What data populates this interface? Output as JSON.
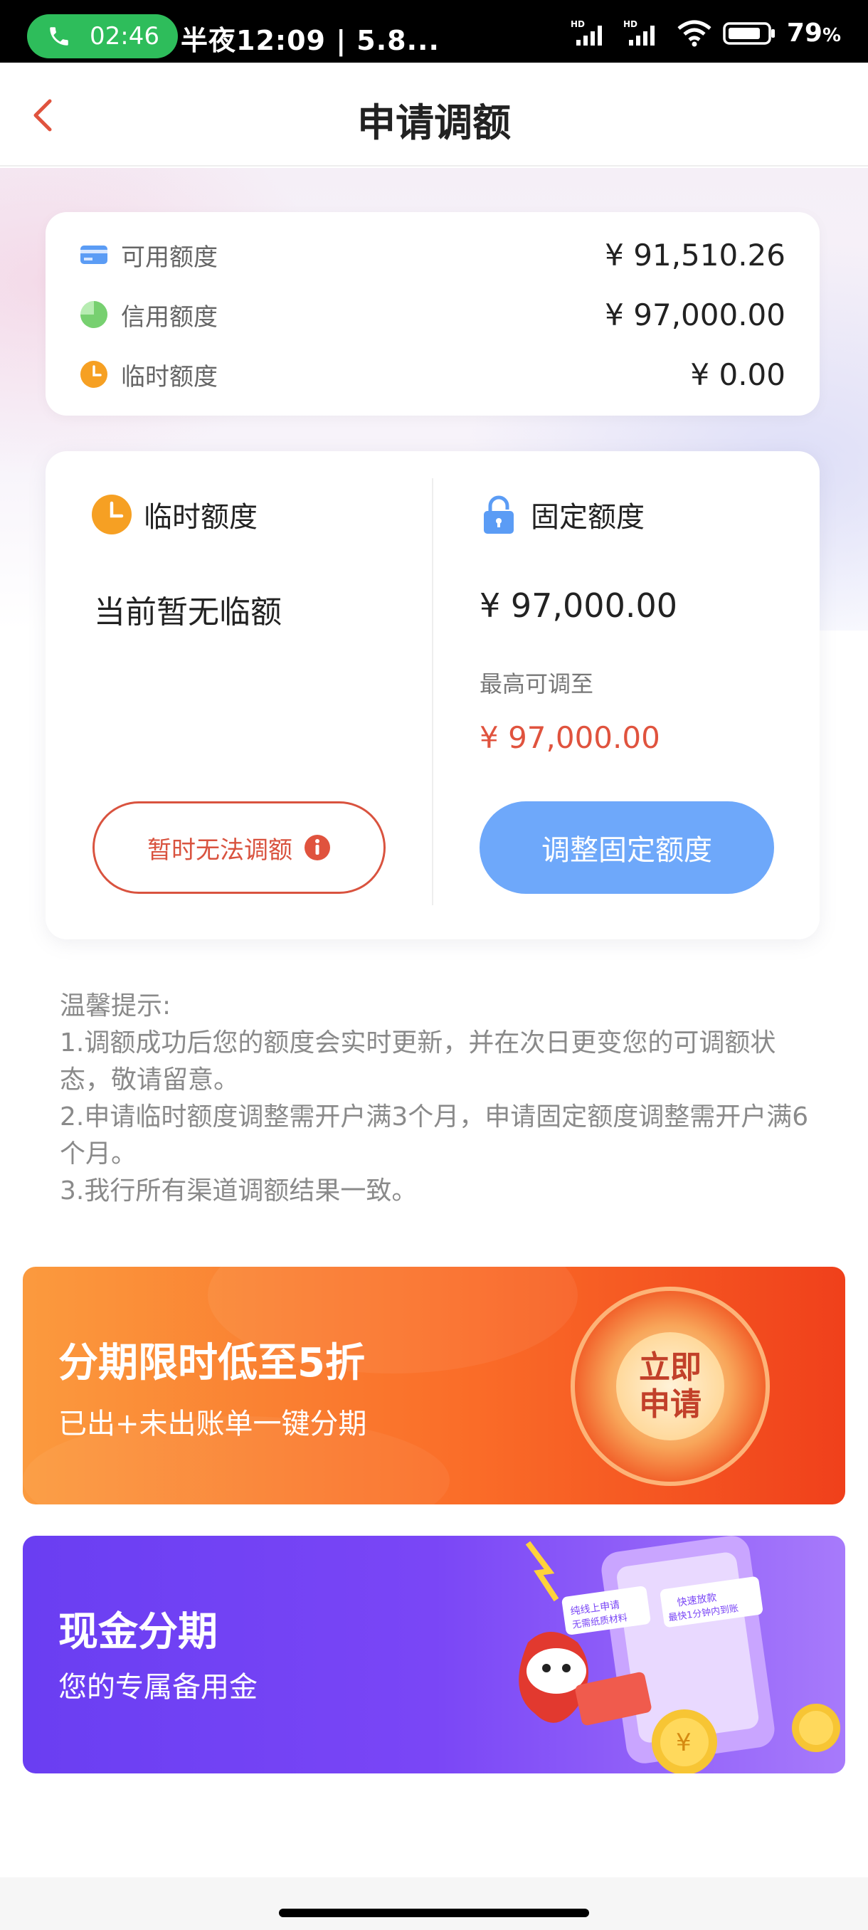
{
  "status_bar": {
    "call_time": "02:46",
    "notification_text": "半夜12:09 | 5.8...",
    "battery": "79",
    "battery_unit": "%",
    "network_label": "HD"
  },
  "header": {
    "title": "申请调额"
  },
  "summary": {
    "rows": [
      {
        "label": "可用额度",
        "value": "¥ 91,510.26",
        "icon": "card-icon",
        "color": "#5b9cf5"
      },
      {
        "label": "信用额度",
        "value": "¥ 97,000.00",
        "icon": "pie-icon",
        "color": "#8fe08a"
      },
      {
        "label": "临时额度",
        "value": "¥ 0.00",
        "icon": "clock-icon",
        "color": "#f6a023"
      }
    ]
  },
  "temp_quota": {
    "title": "临时额度",
    "status": "当前暂无临额",
    "button_label": "暂时无法调额"
  },
  "fixed_quota": {
    "title": "固定额度",
    "amount": "¥ 97,000.00",
    "max_label": "最高可调至",
    "max_amount": "¥ 97,000.00",
    "button_label": "调整固定额度"
  },
  "tips": {
    "title": "温馨提示:",
    "items": [
      "1.调额成功后您的额度会实时更新，并在次日更变您的可调额状态，敬请留意。",
      "2.申请临时额度调整需开户满3个月，申请固定额度调整需开户满6个月。",
      "3.我行所有渠道调额结果一致。"
    ]
  },
  "banners": {
    "installment": {
      "title": "分期限时低至5折",
      "subtitle": "已出+未出账单一键分期",
      "cta_line1": "立即",
      "cta_line2": "申请"
    },
    "cash": {
      "title": "现金分期",
      "subtitle": "您的专属备用金",
      "tag1": "纯线上申请",
      "tag1_sub": "无需纸质材料",
      "tag2": "快速放款",
      "tag2_sub": "最快1分钟内到账"
    }
  },
  "colors": {
    "accent_red": "#e0533e",
    "primary_blue": "#6ea8fa",
    "orange": "#f6a023"
  }
}
